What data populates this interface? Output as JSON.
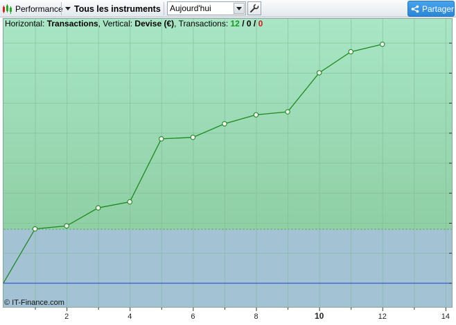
{
  "toolbar": {
    "performance_label": "Performance",
    "instruments_label": "Tous les instruments",
    "period_value": "Aujourd'hui",
    "share_label": "Partager"
  },
  "info_bar": {
    "horizontal_prefix": "Horizontal: ",
    "horizontal_value": "Transactions",
    "vertical_prefix": ", Vertical: ",
    "vertical_value": "Devise (€)",
    "transactions_prefix": ", Transactions: ",
    "transactions_win": "12",
    "sep1": " / ",
    "transactions_neutral": "0",
    "sep2": " / ",
    "transactions_loss": "0"
  },
  "copyright": "© IT-Finance.com",
  "colors": {
    "gain_area_top": "#a8e6c6",
    "gain_area_bottom": "#8fcfa4",
    "loss_area": "#a3c2d4",
    "line": "#1d8a1d",
    "zero_line": "#1f3fd6",
    "win_text": "#1a9a1a",
    "loss_text": "#d11a1a",
    "share_button": "#3598e4"
  },
  "chart_data": {
    "type": "line",
    "x": [
      0,
      1,
      2,
      3,
      4,
      5,
      6,
      7,
      8,
      9,
      10,
      11,
      12
    ],
    "y": [
      0,
      18,
      19,
      25,
      27,
      48,
      48.5,
      53,
      56,
      57,
      70,
      77,
      79.5
    ],
    "xlim": [
      0,
      14.2
    ],
    "ylim": [
      -8,
      88
    ],
    "x_ticks": [
      "2",
      "4",
      "6",
      "8",
      "10",
      "12",
      "14"
    ],
    "bold_tick": "10",
    "xlabel": "Transactions",
    "ylabel": "Devise (€)",
    "grid": true
  }
}
